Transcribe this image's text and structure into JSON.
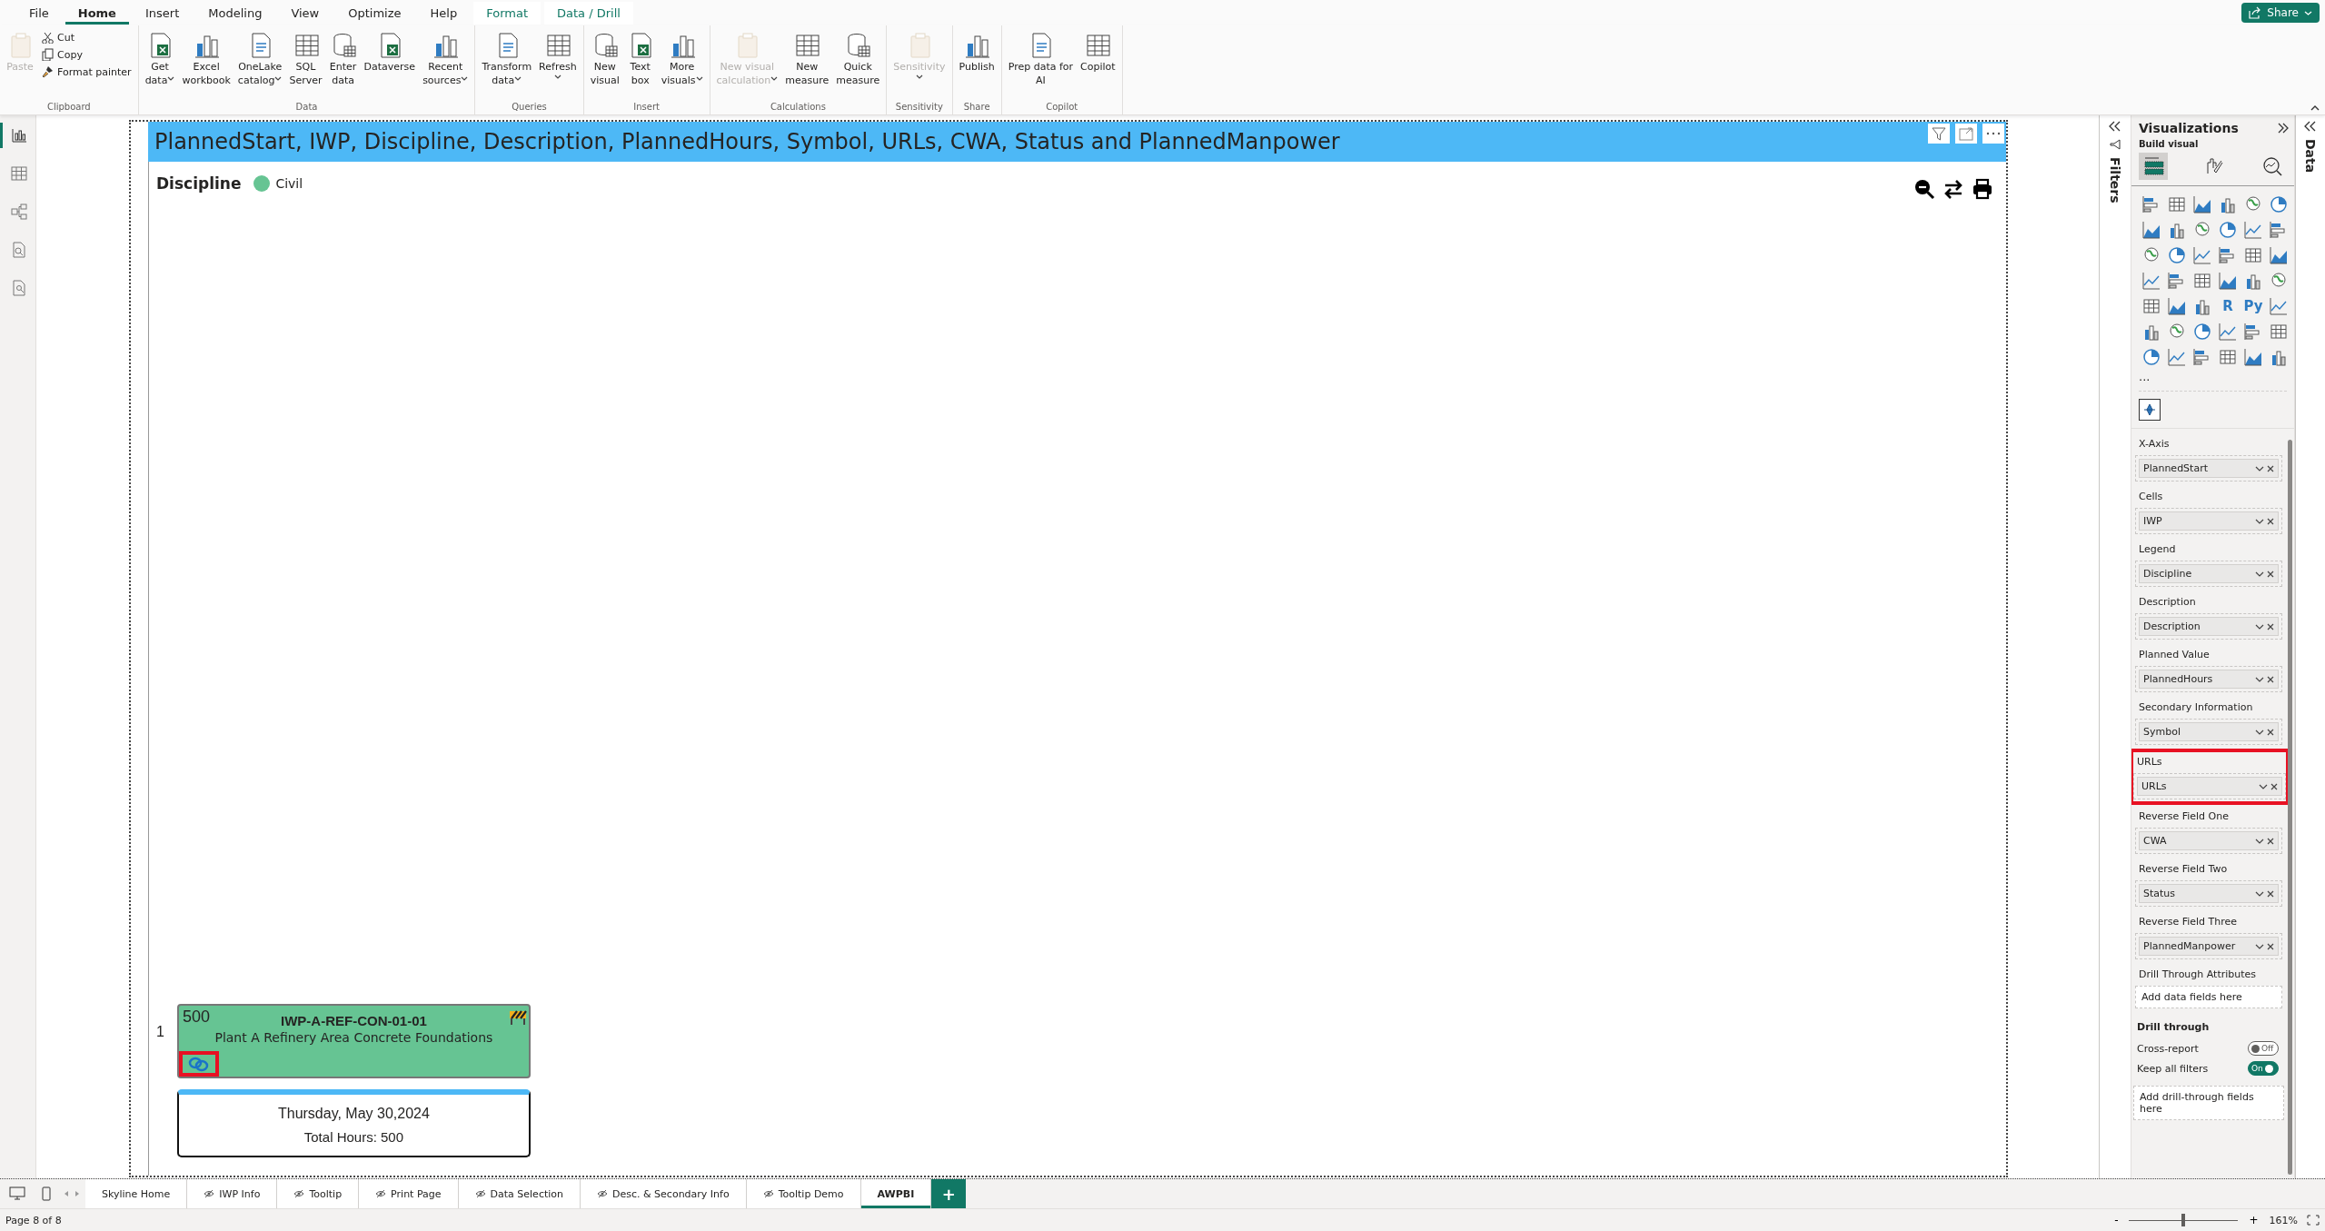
{
  "menu_tabs": [
    {
      "label": "File",
      "selected": false,
      "kind": "normal"
    },
    {
      "label": "Home",
      "selected": true,
      "kind": "normal"
    },
    {
      "label": "Insert",
      "selected": false,
      "kind": "normal"
    },
    {
      "label": "Modeling",
      "selected": false,
      "kind": "normal"
    },
    {
      "label": "View",
      "selected": false,
      "kind": "normal"
    },
    {
      "label": "Optimize",
      "selected": false,
      "kind": "normal"
    },
    {
      "label": "Help",
      "selected": false,
      "kind": "normal"
    },
    {
      "label": "Format",
      "selected": false,
      "kind": "contextual"
    },
    {
      "label": "Data / Drill",
      "selected": false,
      "kind": "contextual"
    }
  ],
  "share_button": {
    "label": "Share"
  },
  "ribbon_groups": [
    {
      "label": "Clipboard",
      "buttons": [
        {
          "kind": "large",
          "lines": [
            "Paste"
          ],
          "dropdown": false,
          "disabled": true
        },
        {
          "kind": "small",
          "lines": [
            "Cut"
          ]
        },
        {
          "kind": "small",
          "lines": [
            "Copy"
          ]
        },
        {
          "kind": "small",
          "lines": [
            "Format painter"
          ]
        }
      ]
    },
    {
      "label": "Data",
      "buttons": [
        {
          "kind": "large",
          "lines": [
            "Get",
            "data"
          ],
          "dropdown": true,
          "disabled": false
        },
        {
          "kind": "large",
          "lines": [
            "Excel",
            "workbook"
          ],
          "dropdown": false,
          "disabled": false
        },
        {
          "kind": "large",
          "lines": [
            "OneLake",
            "catalog"
          ],
          "dropdown": true,
          "disabled": false
        },
        {
          "kind": "large",
          "lines": [
            "SQL",
            "Server"
          ],
          "dropdown": false,
          "disabled": false
        },
        {
          "kind": "large",
          "lines": [
            "Enter",
            "data"
          ],
          "dropdown": false,
          "disabled": false
        },
        {
          "kind": "large",
          "lines": [
            "Dataverse"
          ],
          "dropdown": false,
          "disabled": false
        },
        {
          "kind": "large",
          "lines": [
            "Recent",
            "sources"
          ],
          "dropdown": true,
          "disabled": false
        }
      ]
    },
    {
      "label": "Queries",
      "buttons": [
        {
          "kind": "large",
          "lines": [
            "Transform",
            "data"
          ],
          "dropdown": true,
          "disabled": false
        },
        {
          "kind": "large",
          "lines": [
            "Refresh"
          ],
          "dropdown": true,
          "disabled": false
        }
      ]
    },
    {
      "label": "Insert",
      "buttons": [
        {
          "kind": "large",
          "lines": [
            "New",
            "visual"
          ],
          "dropdown": false,
          "disabled": false
        },
        {
          "kind": "large",
          "lines": [
            "Text",
            "box"
          ],
          "dropdown": false,
          "disabled": false
        },
        {
          "kind": "large",
          "lines": [
            "More",
            "visuals"
          ],
          "dropdown": true,
          "disabled": false
        }
      ]
    },
    {
      "label": "Calculations",
      "buttons": [
        {
          "kind": "large",
          "lines": [
            "New visual",
            "calculation"
          ],
          "dropdown": true,
          "disabled": true
        },
        {
          "kind": "large",
          "lines": [
            "New",
            "measure"
          ],
          "dropdown": false,
          "disabled": false
        },
        {
          "kind": "large",
          "lines": [
            "Quick",
            "measure"
          ],
          "dropdown": false,
          "disabled": false
        }
      ]
    },
    {
      "label": "Sensitivity",
      "buttons": [
        {
          "kind": "large",
          "lines": [
            "Sensitivity"
          ],
          "dropdown": true,
          "disabled": true
        }
      ]
    },
    {
      "label": "Share",
      "buttons": [
        {
          "kind": "large",
          "lines": [
            "Publish"
          ],
          "dropdown": false,
          "disabled": false
        }
      ]
    },
    {
      "label": "Copilot",
      "buttons": [
        {
          "kind": "large",
          "lines": [
            "Prep data for",
            "AI"
          ],
          "dropdown": false,
          "disabled": false
        },
        {
          "kind": "large",
          "lines": [
            "Copilot"
          ],
          "dropdown": false,
          "disabled": false
        }
      ]
    }
  ],
  "left_nav": [
    {
      "selected": true
    },
    {
      "selected": false
    },
    {
      "selected": false
    },
    {
      "selected": false
    },
    {
      "selected": false
    }
  ],
  "visual": {
    "title": "PlannedStart, IWP, Discipline, Description, PlannedHours, Symbol, URLs, CWA, Status and PlannedManpower",
    "legend": {
      "title": "Discipline",
      "items": [
        {
          "label": "Civil",
          "color": "#66c493"
        }
      ]
    },
    "row_label": "1",
    "card": {
      "value": "500",
      "id": "IWP-A-REF-CON-01-01",
      "description": "Plant A Refinery Area Concrete Foundations",
      "link_highlighted": true
    },
    "date_card": {
      "date": "Thursday, May 30,2024",
      "total": "Total Hours: 500"
    }
  },
  "filters_pane": {
    "label": "Filters"
  },
  "visualizations": {
    "title": "Visualizations",
    "subtitle": "Build visual",
    "build_tabs": [
      {
        "selected": true
      },
      {
        "selected": false
      },
      {
        "selected": false
      }
    ],
    "text_icons": [
      "R",
      "Py"
    ],
    "more": "...",
    "wells": [
      {
        "label": "X-Axis",
        "field": "PlannedStart",
        "highlighted": false
      },
      {
        "label": "Cells",
        "field": "IWP",
        "highlighted": false
      },
      {
        "label": "Legend",
        "field": "Discipline",
        "highlighted": false
      },
      {
        "label": "Description",
        "field": "Description",
        "highlighted": false
      },
      {
        "label": "Planned Value",
        "field": "PlannedHours",
        "highlighted": false
      },
      {
        "label": "Secondary Information",
        "field": "Symbol",
        "highlighted": false
      },
      {
        "label": "URLs",
        "field": "URLs",
        "highlighted": true
      },
      {
        "label": "Reverse Field One",
        "field": "CWA",
        "highlighted": false
      },
      {
        "label": "Reverse Field Two",
        "field": "Status",
        "highlighted": false
      },
      {
        "label": "Reverse Field Three",
        "field": "PlannedManpower",
        "highlighted": false
      }
    ],
    "drill_attributes": {
      "label": "Drill Through Attributes",
      "placeholder": "Add data fields here"
    },
    "drill_through": {
      "title": "Drill through",
      "toggles": [
        {
          "label": "Cross-report",
          "on": false,
          "state_text": "Off"
        },
        {
          "label": "Keep all filters",
          "on": true,
          "state_text": "On"
        }
      ],
      "placeholder": "Add drill-through fields here"
    }
  },
  "data_pane": {
    "label": "Data"
  },
  "page_tabs": [
    {
      "label": "Skyline Home",
      "hidden": false,
      "selected": false
    },
    {
      "label": "IWP Info",
      "hidden": true,
      "selected": false
    },
    {
      "label": "Tooltip",
      "hidden": true,
      "selected": false
    },
    {
      "label": "Print Page",
      "hidden": true,
      "selected": false
    },
    {
      "label": "Data Selection",
      "hidden": true,
      "selected": false
    },
    {
      "label": "Desc. & Secondary Info",
      "hidden": true,
      "selected": false
    },
    {
      "label": "Tooltip Demo",
      "hidden": true,
      "selected": false
    },
    {
      "label": "AWPBI",
      "hidden": false,
      "selected": true
    }
  ],
  "add_page": "+",
  "status_bar": {
    "page": "Page 8 of 8",
    "zoom_minus": "-",
    "zoom_plus": "+",
    "level": 0.5,
    "zoom": "161%"
  }
}
